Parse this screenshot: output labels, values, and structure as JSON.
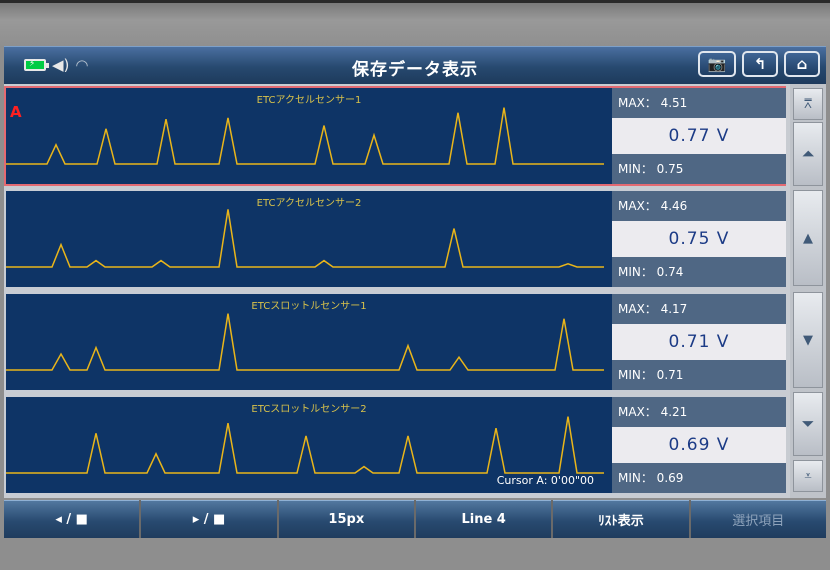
{
  "header": {
    "title": "保存データ表示",
    "battery_icon": "battery-charging-icon",
    "speaker_icon": "speaker-icon",
    "wifi_icon": "wifi-icon",
    "buttons": [
      {
        "name": "screen-capture-button",
        "icon": "camera-icon",
        "glyph": "📷"
      },
      {
        "name": "back-button",
        "icon": "back-arrow-icon",
        "glyph": "↰"
      },
      {
        "name": "home-button",
        "icon": "home-icon",
        "glyph": "⌂"
      }
    ]
  },
  "rows": [
    {
      "title": "ETCアクセルセンサー1",
      "marker": "A",
      "max": "MAX： 4.51",
      "value": "0.77 V",
      "min": "MIN： 0.75",
      "selected": true,
      "baseline": 0.77,
      "peaks": [
        [
          50,
          0.3
        ],
        [
          100,
          0.55
        ],
        [
          160,
          0.7
        ],
        [
          222,
          0.72
        ],
        [
          318,
          0.6
        ],
        [
          368,
          0.45
        ],
        [
          452,
          0.8
        ],
        [
          498,
          0.88
        ]
      ]
    },
    {
      "title": "ETCアクセルセンサー2",
      "max": "MAX： 4.46",
      "value": "0.75 V",
      "min": "MIN： 0.74",
      "selected": false,
      "baseline": 0.75,
      "peaks": [
        [
          55,
          0.35
        ],
        [
          90,
          0.1
        ],
        [
          155,
          0.1
        ],
        [
          222,
          0.9
        ],
        [
          318,
          0.1
        ],
        [
          448,
          0.6
        ],
        [
          562,
          0.05
        ]
      ]
    },
    {
      "title": "ETCスロットルセンサー1",
      "max": "MAX： 4.17",
      "value": "0.71 V",
      "min": "MIN： 0.71",
      "selected": false,
      "baseline": 0.71,
      "peaks": [
        [
          55,
          0.25
        ],
        [
          90,
          0.35
        ],
        [
          222,
          0.88
        ],
        [
          402,
          0.38
        ],
        [
          453,
          0.2
        ],
        [
          558,
          0.8
        ]
      ]
    },
    {
      "title": "ETCスロットルセンサー2",
      "max": "MAX： 4.21",
      "value": "0.69 V",
      "min": "MIN： 0.69",
      "selected": false,
      "baseline": 0.69,
      "cursor": "Cursor A: 0'00\"00",
      "peaks": [
        [
          90,
          0.62
        ],
        [
          150,
          0.3
        ],
        [
          222,
          0.78
        ],
        [
          300,
          0.58
        ],
        [
          358,
          0.1
        ],
        [
          402,
          0.58
        ],
        [
          490,
          0.7
        ],
        [
          562,
          0.88
        ]
      ]
    }
  ],
  "scroll": {
    "top_icon": "scroll-top-icon",
    "page_up_icon": "page-up-icon",
    "up_icon": "scroll-up-icon",
    "down_icon": "scroll-down-icon",
    "page_down_icon": "page-down-icon",
    "bottom_icon": "scroll-bottom-icon"
  },
  "bottom": {
    "prev_label": "◂ / ■",
    "next_label": "▸ / ■",
    "scale_label": "15px",
    "line_label": "Line 4",
    "list_label": "ﾘｽﾄ表示",
    "select_label": "選択項目"
  },
  "colors": {
    "graph_bg": "#0e3466",
    "trace": "#e9b51a",
    "selected_border": "#e36a72"
  }
}
